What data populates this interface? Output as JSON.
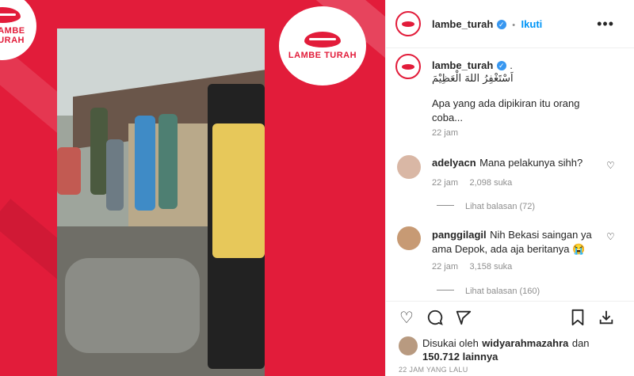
{
  "media": {
    "logo_text": "LAMBE TURAH"
  },
  "header": {
    "username": "lambe_turah",
    "verified": "✓",
    "separator": "•",
    "follow_label": "Ikuti",
    "more_icon": "more-horizontal-icon"
  },
  "caption": {
    "username": "lambe_turah",
    "suffix": ".",
    "arabic": "اَسْتَغْفِرُ اللهَ الْعَظِيْمَ",
    "text": "Apa yang ada dipikiran itu orang coba...",
    "time": "22 jam"
  },
  "comments": [
    {
      "username": "adelyacn",
      "text": "Mana pelakunya sihh?",
      "time": "22 jam",
      "likes": "2,098 suka",
      "replies": "Lihat balasan (72)"
    },
    {
      "username": "panggilagil",
      "text": "Nih Bekasi saingan ya ama Depok, ada aja beritanya 😭",
      "time": "22 jam",
      "likes": "3,158 suka",
      "replies": "Lihat balasan (160)"
    }
  ],
  "likes": {
    "prefix": "Disukai oleh",
    "user": "widyarahmazahra",
    "conj": "dan",
    "count": "150.712 lainnya"
  },
  "timestamp": "22 JAM YANG LALU",
  "colors": {
    "brand_red": "#e21c3a",
    "link_blue": "#0095f6"
  }
}
